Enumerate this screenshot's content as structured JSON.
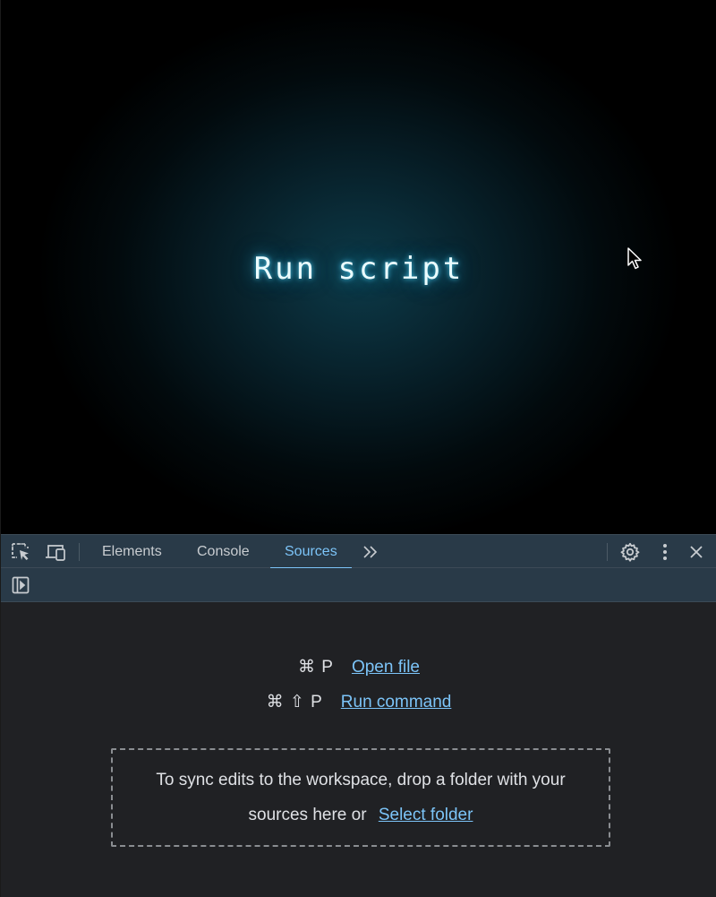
{
  "page": {
    "run_script_label": "Run script"
  },
  "devtools": {
    "toolbar": {
      "inspect_icon": "inspect-element-icon",
      "device_icon": "device-toolbar-icon",
      "tabs": [
        "Elements",
        "Console",
        "Sources"
      ],
      "active_tab": "Sources",
      "more_tabs_icon": "chevron-double-right-icon",
      "settings_icon": "gear-icon",
      "menu_icon": "kebab-menu-icon",
      "close_icon": "close-icon"
    },
    "sources": {
      "sidebar_toggle_icon": "show-navigator-icon",
      "open_file": {
        "keys": "⌘ P",
        "label": "Open file"
      },
      "run_command": {
        "keys": "⌘ ⇧ P",
        "label": "Run command"
      },
      "workspace": {
        "line1": "To sync edits to the workspace, drop a folder with your",
        "line2_prefix": "sources here or",
        "select_folder_label": "Select folder"
      }
    }
  },
  "colors": {
    "accent": "#7cc4f8",
    "toolbar_bg": "#293a48",
    "panel_bg": "#202124",
    "glow": "#3cc8ff"
  }
}
